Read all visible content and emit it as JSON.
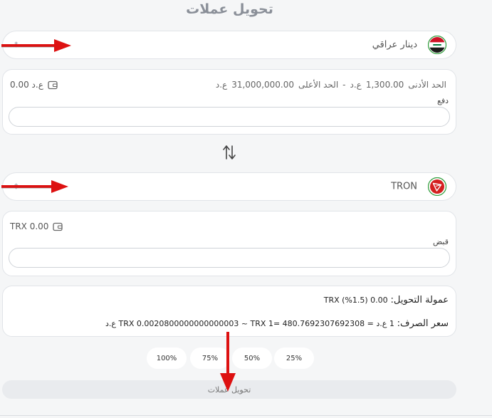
{
  "title": "تحويل عملات",
  "from": {
    "currency_name": "دينار عراقي",
    "flag_icon": "iraq-flag-icon",
    "balance": "0.00 ع.د",
    "limits": {
      "min_label": "الحد الأدنى",
      "min_value": "1,300.00",
      "min_unit": "ع.د",
      "separator": "-",
      "max_label": "الحد الأعلى",
      "max_value": "31,000,000.00",
      "max_unit": "ع.د"
    },
    "field_label": "دفع",
    "input_value": ""
  },
  "to": {
    "currency_name": "TRON",
    "logo_icon": "tron-logo-icon",
    "balance": "TRX 0.00",
    "field_label": "قبض",
    "input_value": ""
  },
  "summary": {
    "fee_label": "عمولة التحويل:",
    "fee_value": "0.00 TRX (%1.5)",
    "rate_label": "سعر الصرف:",
    "rate_value": "1 ع.د = TRX 0.0020800000000000003 ~ TRX 1= 480.7692307692308 ع.د"
  },
  "percent_buttons": [
    "25%",
    "50%",
    "75%",
    "100%"
  ],
  "submit_label": "تحويل عملات",
  "colors": {
    "arrow": "#dd1111",
    "tron_red": "#d42020",
    "page_bg": "#f5f6f7"
  }
}
